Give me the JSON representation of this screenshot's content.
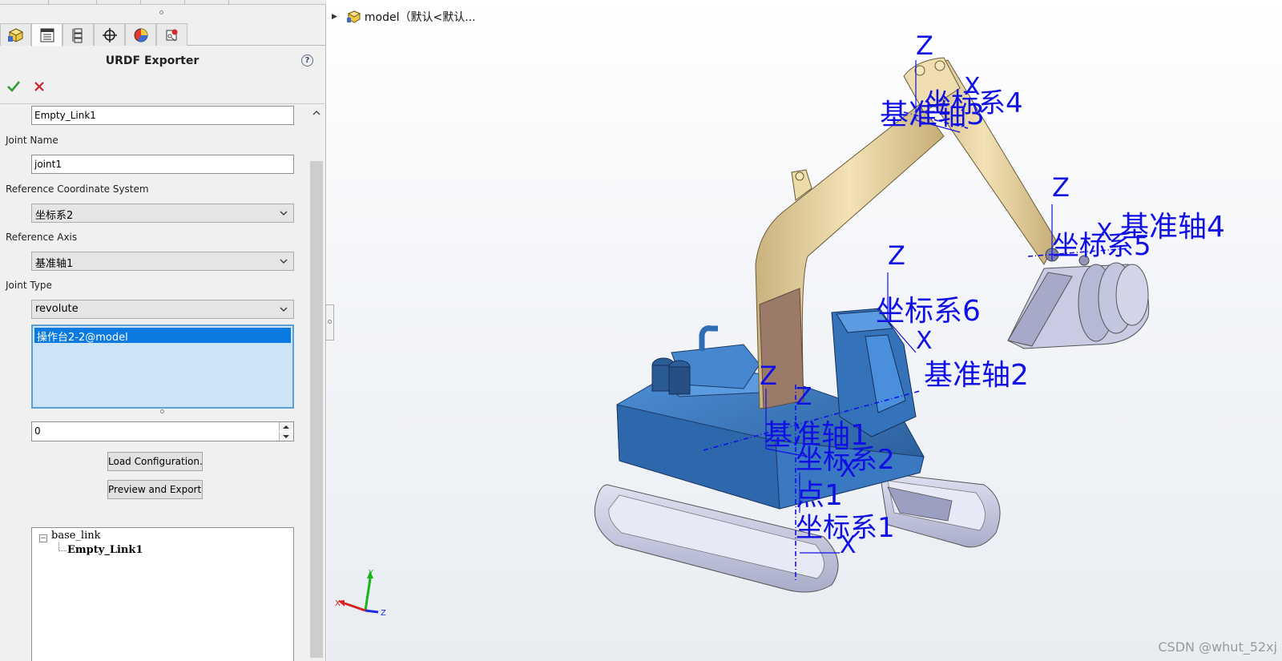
{
  "panel": {
    "title": "URDF Exporter",
    "help_symbol": "?",
    "link_name_value": "Empty_Link1",
    "joint_name_label": "Joint Name",
    "joint_name_value": "joint1",
    "ref_coord_label": "Reference Coordinate System",
    "ref_coord_value": "坐标系2",
    "ref_axis_label": "Reference Axis",
    "ref_axis_value": "基准轴1",
    "joint_type_label": "Joint Type",
    "joint_type_value": "revolute",
    "components": [
      "操作台2-2@model"
    ],
    "numeric_value": "0",
    "load_button": "Load Configuration..",
    "export_button": "Preview and Export..",
    "tree": {
      "root": "base_link",
      "child": "Empty_Link1"
    }
  },
  "viewport": {
    "breadcrumb": "model（默认<默认...",
    "watermark": "CSDN @whut_52xj",
    "labels": {
      "z": "Z",
      "x": "X",
      "y": "Y",
      "axis1": "基准轴1",
      "axis2": "基准轴2",
      "axis3": "基准轴3",
      "axis4": "基准轴4",
      "coord1": "坐标系1",
      "coord2": "坐标系2",
      "coord4": "坐标系4",
      "coord5": "坐标系5",
      "coord6": "坐标系6",
      "point1": "点1"
    }
  },
  "colors": {
    "annotation": "#1010e6",
    "arm": "#e9d6a6",
    "body": "#3b78c0",
    "track": "#c4c8df",
    "selection": "#0a7ae0"
  }
}
